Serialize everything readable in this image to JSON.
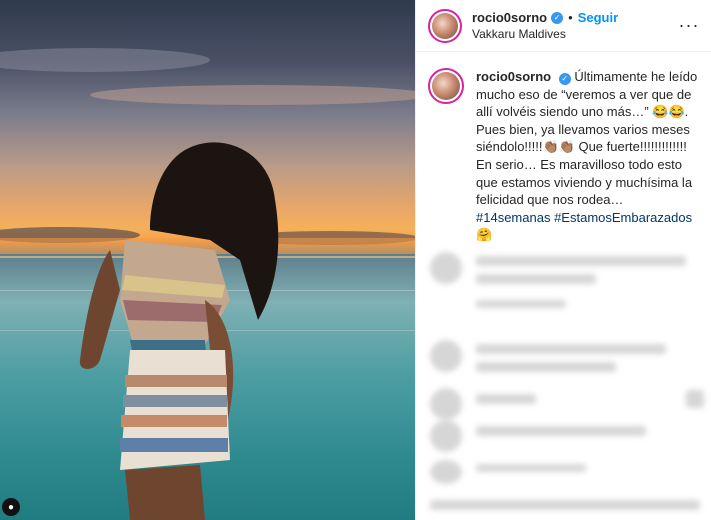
{
  "post": {
    "username": "rocio0sorno",
    "follow_label": "Seguir",
    "separator": "•",
    "location": "Vakkaru Maldives",
    "more_label": "···",
    "verified_mark": "✓",
    "photo_badge": "●"
  },
  "caption": {
    "username": "rocio0sorno",
    "text": "Últimamente he leído mucho eso de “veremos a ver que de allí volvéis siendo uno más…” 😂😂. Pues bien, ya llevamos varios meses siéndolo!!!!!👏🏽👏🏽 Que fuerte!!!!!!!!!!!!! En serio… Es maravilloso todo esto que estamos viviendo y muchísima la felicidad que nos rodea… ",
    "hashtag1": "#14semanas",
    "hashtag2": "#EstamosEmbarazados",
    "emoji_end": "🤗"
  },
  "colors": {
    "link": "#0095f6",
    "verified": "#3897f0",
    "hashtag": "#00376b"
  },
  "icons": [
    "verified-icon",
    "more-options-icon",
    "user-tag-icon"
  ]
}
